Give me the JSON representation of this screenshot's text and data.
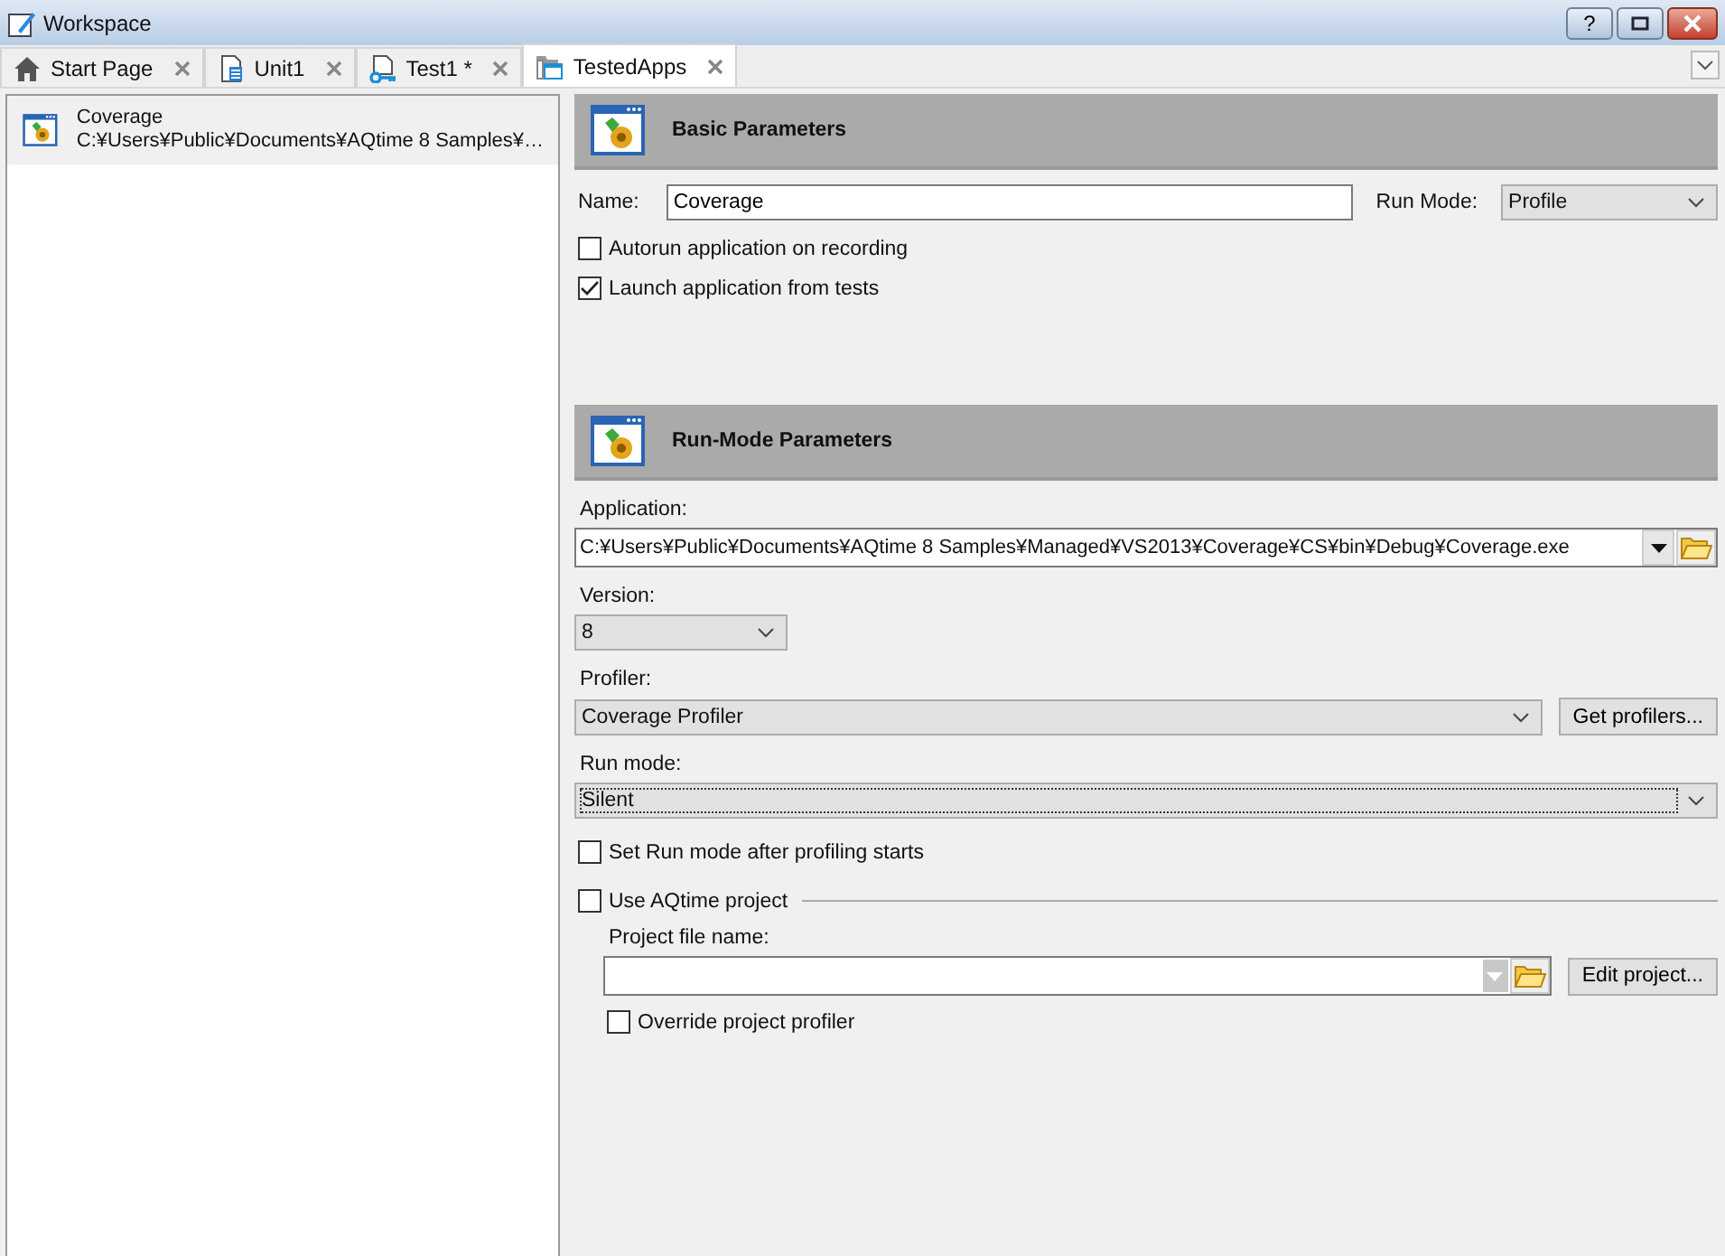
{
  "window": {
    "title": "Workspace",
    "help_button": "?"
  },
  "tabs": [
    {
      "label": "Start Page",
      "kind": "home",
      "selected": false
    },
    {
      "label": "Unit1",
      "kind": "document",
      "selected": false
    },
    {
      "label": "Test1 *",
      "kind": "key",
      "selected": false
    },
    {
      "label": "TestedApps",
      "kind": "window",
      "selected": true
    }
  ],
  "apps": [
    {
      "name": "Coverage",
      "path": "C:¥Users¥Public¥Documents¥AQtime 8 Samples¥…",
      "selected": true
    }
  ],
  "basic": {
    "title": "Basic Parameters",
    "name_label": "Name:",
    "name_value": "Coverage",
    "run_mode_label": "Run Mode:",
    "run_mode_value": "Profile",
    "checkboxes": [
      {
        "label": "Autorun application on recording",
        "checked": false
      },
      {
        "label": "Launch application from tests",
        "checked": true
      }
    ]
  },
  "run_mode_params": {
    "title": "Run-Mode Parameters",
    "application_label": "Application:",
    "application_value": "C:¥Users¥Public¥Documents¥AQtime 8 Samples¥Managed¥VS2013¥Coverage¥CS¥bin¥Debug¥Coverage.exe",
    "version_label": "Version:",
    "version_value": "8",
    "profiler_label": "Profiler:",
    "profiler_value": "Coverage Profiler",
    "get_profilers_button": "Get profilers...",
    "run_mode_label": "Run mode:",
    "run_mode_value": "Silent",
    "set_run_mode": {
      "label": "Set Run mode after profiling starts",
      "checked": false
    },
    "use_project": {
      "label": "Use AQtime project",
      "checked": false
    },
    "project_file_label": "Project file name:",
    "edit_project_button": "Edit project...",
    "override": {
      "label": "Override project profiler",
      "checked": false
    }
  }
}
